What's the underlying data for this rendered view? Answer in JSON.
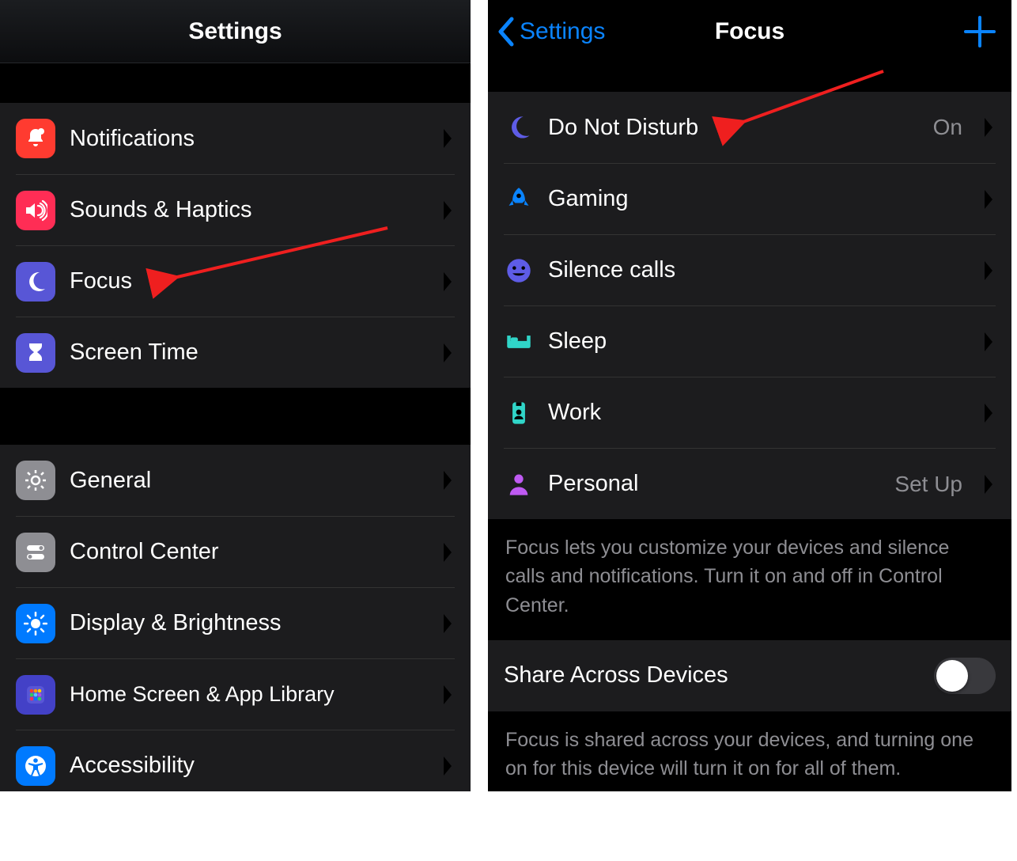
{
  "left": {
    "title": "Settings",
    "group1": [
      {
        "label": "Notifications",
        "icon": "bell",
        "bg": "#ff3b30"
      },
      {
        "label": "Sounds & Haptics",
        "icon": "speaker",
        "bg": "#ff2d55"
      },
      {
        "label": "Focus",
        "icon": "moon",
        "bg": "#5856d6"
      },
      {
        "label": "Screen Time",
        "icon": "hourglass",
        "bg": "#5856d6"
      }
    ],
    "group2": [
      {
        "label": "General",
        "icon": "gear",
        "bg": "#8e8e93"
      },
      {
        "label": "Control Center",
        "icon": "toggles",
        "bg": "#8e8e93"
      },
      {
        "label": "Display & Brightness",
        "icon": "sun",
        "bg": "#007aff"
      },
      {
        "label": "Home Screen & App Library",
        "icon": "grid",
        "bg": "#5856d6"
      },
      {
        "label": "Accessibility",
        "icon": "accessibility",
        "bg": "#007aff"
      }
    ]
  },
  "right": {
    "back": "Settings",
    "title": "Focus",
    "items": [
      {
        "label": "Do Not Disturb",
        "icon": "moon",
        "color": "#5e5ce6",
        "detail": "On"
      },
      {
        "label": "Gaming",
        "icon": "rocket",
        "color": "#0a84ff",
        "detail": ""
      },
      {
        "label": "Silence calls",
        "icon": "smile",
        "color": "#5e5ce6",
        "detail": ""
      },
      {
        "label": "Sleep",
        "icon": "bed",
        "color": "#30d5c8",
        "detail": ""
      },
      {
        "label": "Work",
        "icon": "badge",
        "color": "#30d5c8",
        "detail": ""
      },
      {
        "label": "Personal",
        "icon": "person",
        "color": "#bf5af2",
        "detail": "Set Up"
      }
    ],
    "footer1": "Focus lets you customize your devices and silence calls and notifications. Turn it on and off in Control Center.",
    "share_label": "Share Across Devices",
    "footer2": "Focus is shared across your devices, and turning one on for this device will turn it on for all of them."
  }
}
